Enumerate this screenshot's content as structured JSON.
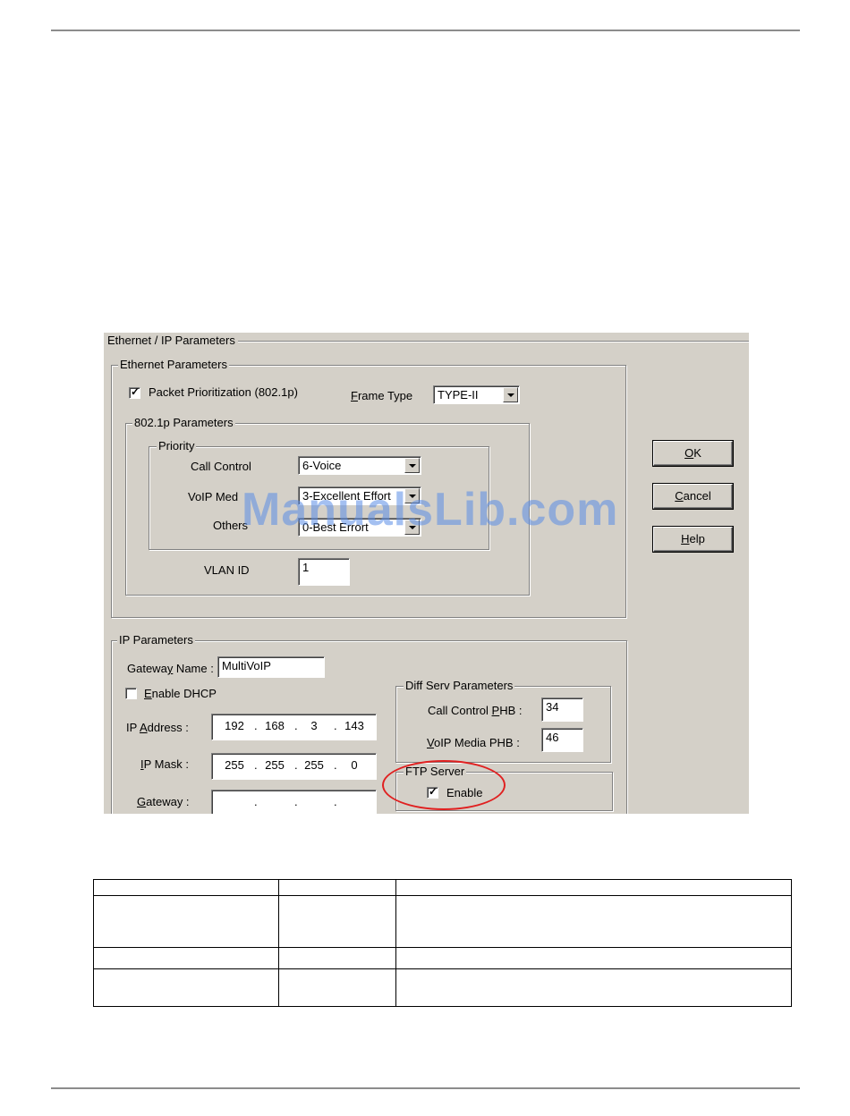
{
  "dialog": {
    "title": "Ethernet / IP Parameters",
    "ethernet": {
      "title": "Ethernet Parameters",
      "packet_prioritization": {
        "label": "Packet Prioritization (802.1p)",
        "checked": true,
        "check_glyph": "✓"
      },
      "frame_type": {
        "label_prefix": "F",
        "label_rest": "rame Type",
        "value": "TYPE-II"
      },
      "p8021": {
        "title": "802.1p Parameters",
        "priority": {
          "title": "Priority",
          "call_control": {
            "label": "Call Control",
            "value": "6-Voice"
          },
          "voip_media": {
            "label": "VoIP Med",
            "value": "3-Excellent Effort"
          },
          "others": {
            "label": "Others",
            "value": "0-Best Errort"
          }
        },
        "vlan": {
          "label": "VLAN ID",
          "value": "1"
        }
      }
    },
    "ip": {
      "title": "IP Parameters",
      "gateway_name": {
        "label_a": "Gatewa",
        "label_b": "y",
        "label_c": " Name :",
        "value": "MultiVoIP"
      },
      "enable_dhcp": {
        "label_a": "E",
        "label_b": "nable DHCP",
        "checked": false
      },
      "ip_address": {
        "label_a": "IP ",
        "label_b": "A",
        "label_c": "ddress :",
        "octets": [
          "192",
          "168",
          "3",
          "143"
        ]
      },
      "ip_mask": {
        "label_a": "I",
        "label_b": "P Mask :",
        "octets": [
          "255",
          "255",
          "255",
          "0"
        ]
      },
      "gateway": {
        "label_a": "G",
        "label_b": "ateway :",
        "octets": [
          "",
          "",
          "",
          ""
        ]
      },
      "octet_separator": ".",
      "diffserv": {
        "title": "Diff Serv Parameters",
        "call_control_phb": {
          "label_a": "Call Control ",
          "label_b": "P",
          "label_c": "HB :",
          "value": "34"
        },
        "voip_media_phb": {
          "label_a": "V",
          "label_b": "oIP Media PHB :",
          "value": "46"
        }
      },
      "ftp": {
        "title": "FTP Server",
        "enable_label": "Enable",
        "checked": true,
        "check_glyph": "✓"
      }
    },
    "buttons": {
      "ok": {
        "a": "O",
        "b": "K"
      },
      "cancel": {
        "a": "C",
        "b": "ancel"
      },
      "help": {
        "a": "H",
        "b": "elp"
      }
    }
  },
  "watermark": "ManualsLib.com",
  "colors": {
    "dialog_bg": "#d4d0c8",
    "highlight": "#e02020",
    "watermark": "#5a8ce6"
  }
}
